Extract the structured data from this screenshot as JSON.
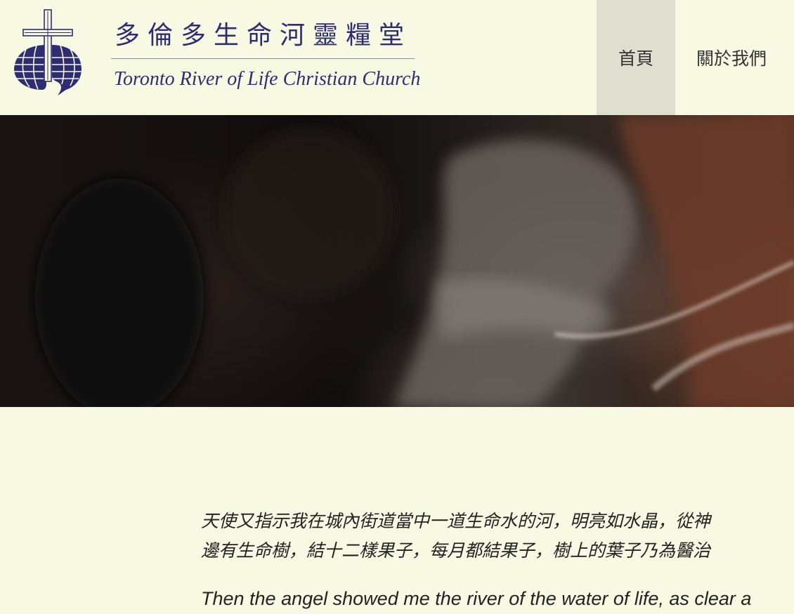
{
  "header": {
    "brand_cn": "多倫多生命河靈糧堂",
    "brand_en": "Toronto River of Life Christian Church",
    "logo_icon": "church-cross-globe-icon"
  },
  "nav": {
    "items": [
      {
        "label": "首頁",
        "active": true
      },
      {
        "label": "關於我們",
        "active": false
      }
    ]
  },
  "hero": {
    "image": "worship-photo"
  },
  "verse": {
    "cn_line1": "天使又指示我在城內街道當中一道生命水的河，明亮如水晶，從神",
    "cn_line2": "邊有生命樹，結十二樣果子，每月都結果子，樹上的葉子乃為醫治",
    "en_line1": "Then the angel showed me the river of the water of life, as clear a"
  },
  "colors": {
    "background": "#f8f9e3",
    "brand": "#2e2d72",
    "nav_active": "#dfdfd0",
    "text": "#222222"
  }
}
